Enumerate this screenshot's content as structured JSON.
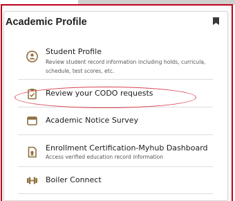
{
  "card": {
    "title": "Academic Profile",
    "bookmark_icon": "bookmark-icon"
  },
  "items": [
    {
      "title": "Student Profile",
      "description": "Review student record information including holds, curricula, schedule, test scores, etc.",
      "icon": "student-profile-icon"
    },
    {
      "title": "Review your CODO requests",
      "description": "",
      "icon": "clipboard-icon"
    },
    {
      "title": "Academic Notice Survey",
      "description": "",
      "icon": "window-icon"
    },
    {
      "title": "Enrollment Certification-Myhub Dashboard",
      "description": "Access verified education record information",
      "icon": "certificate-icon"
    },
    {
      "title": "Boiler Connect",
      "description": "",
      "icon": "dumbbell-icon"
    }
  ],
  "colors": {
    "frame_border": "#c0001a",
    "highlight_ellipse": "#d9414f",
    "icon_gold": "#8e6f3e"
  }
}
